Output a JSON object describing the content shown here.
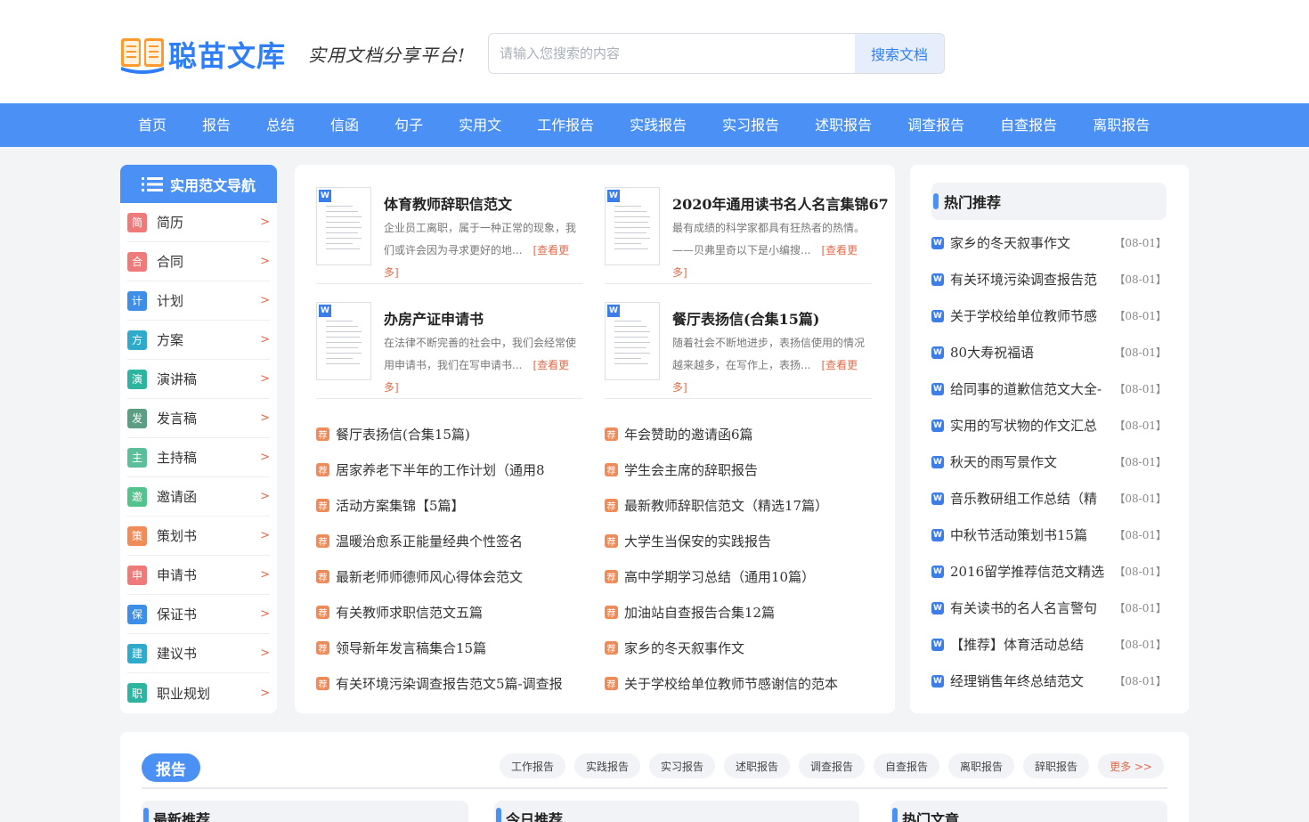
{
  "header": {
    "logo_text": "聪苗文库",
    "slogan": "实用文档分享平台!",
    "search_placeholder": "请输入您搜索的内容",
    "search_button": "搜索文档"
  },
  "nav": [
    "首页",
    "报告",
    "总结",
    "信函",
    "句子",
    "实用文",
    "工作报告",
    "实践报告",
    "实习报告",
    "述职报告",
    "调查报告",
    "自查报告",
    "离职报告"
  ],
  "sidebar": {
    "title": "实用范文导航",
    "items": [
      {
        "icon": "简",
        "label": "简历",
        "color": "#ef7a7a"
      },
      {
        "icon": "合",
        "label": "合同",
        "color": "#ef7a7a"
      },
      {
        "icon": "计",
        "label": "计划",
        "color": "#3c8ee6"
      },
      {
        "icon": "方",
        "label": "方案",
        "color": "#30aacb"
      },
      {
        "icon": "演",
        "label": "演讲稿",
        "color": "#2eb5a2"
      },
      {
        "icon": "发",
        "label": "发言稿",
        "color": "#5b9e84"
      },
      {
        "icon": "主",
        "label": "主持稿",
        "color": "#5bbf9c"
      },
      {
        "icon": "邀",
        "label": "邀请函",
        "color": "#53c28c"
      },
      {
        "icon": "策",
        "label": "策划书",
        "color": "#ef8c58"
      },
      {
        "icon": "申",
        "label": "申请书",
        "color": "#ef7a7a"
      },
      {
        "icon": "保",
        "label": "保证书",
        "color": "#3c8ee6"
      },
      {
        "icon": "建",
        "label": "建议书",
        "color": "#30aacb"
      },
      {
        "icon": "职",
        "label": "职业规划",
        "color": "#2eb5a2"
      }
    ],
    "arrow": ">"
  },
  "featured": [
    {
      "title": "体育教师辞职信范文",
      "desc": "企业员工离职，属于一种正常的现象，我们或许会因为寻求更好的地...",
      "more": "[查看更多]"
    },
    {
      "title": "2020年通用读书名人名言集锦67",
      "desc": "最有成绩的科学家都具有狂热者的热情。——贝弗里奇以下是小编搜...",
      "more": "[查看更多]"
    },
    {
      "title": "办房产证申请书",
      "desc": "在法律不断完善的社会中，我们会经常使用申请书，我们在写申请书...",
      "more": "[查看更多]"
    },
    {
      "title": "餐厅表扬信(合集15篇)",
      "desc": "随着社会不断地进步，表扬信使用的情况越来越多，在写作上，表扬...",
      "more": "[查看更多]"
    }
  ],
  "rec_badge": "荐",
  "rec_left": [
    "餐厅表扬信(合集15篇)",
    "居家养老下半年的工作计划（通用8",
    "活动方案集锦【5篇】",
    "温暖治愈系正能量经典个性签名",
    "最新老师师德师风心得体会范文",
    "有关教师求职信范文五篇",
    "领导新年发言稿集合15篇",
    "有关环境污染调查报告范文5篇-调查报"
  ],
  "rec_right": [
    "年会赞助的邀请函6篇",
    "学生会主席的辞职报告",
    "最新教师辞职信范文（精选17篇）",
    "大学生当保安的实践报告",
    "高中学期学习总结（通用10篇）",
    "加油站自查报告合集12篇",
    "家乡的冬天叙事作文",
    "关于学校给单位教师节感谢信的范本"
  ],
  "hot": {
    "title": "热门推荐",
    "badge": "W",
    "items": [
      {
        "title": "家乡的冬天叙事作文",
        "date": "【08-01】"
      },
      {
        "title": "有关环境污染调查报告范",
        "date": "【08-01】"
      },
      {
        "title": "关于学校给单位教师节感",
        "date": "【08-01】"
      },
      {
        "title": "80大寿祝福语",
        "date": "【08-01】"
      },
      {
        "title": "给同事的道歉信范文大全-",
        "date": "【08-01】"
      },
      {
        "title": "实用的写状物的作文汇总",
        "date": "【08-01】"
      },
      {
        "title": "秋天的雨写景作文",
        "date": "【08-01】"
      },
      {
        "title": "音乐教研组工作总结（精",
        "date": "【08-01】"
      },
      {
        "title": "中秋节活动策划书15篇",
        "date": "【08-01】"
      },
      {
        "title": "2016留学推荐信范文精选",
        "date": "【08-01】"
      },
      {
        "title": "有关读书的名人名言警句",
        "date": "【08-01】"
      },
      {
        "title": "【推荐】体育活动总结",
        "date": "【08-01】"
      },
      {
        "title": "经理销售年终总结范文",
        "date": "【08-01】"
      }
    ]
  },
  "report_section": {
    "title": "报告",
    "tags": [
      "工作报告",
      "实践报告",
      "实习报告",
      "述职报告",
      "调查报告",
      "自查报告",
      "离职报告",
      "辞职报告"
    ],
    "more": "更多 >>",
    "subs": [
      "最新推荐",
      "今日推荐",
      "热门文章"
    ]
  },
  "colors": {
    "accent": "#4a90f5",
    "link_orange": "#e06c4c",
    "badge_orange": "#ee8b59",
    "word_blue": "#3c7de8"
  }
}
